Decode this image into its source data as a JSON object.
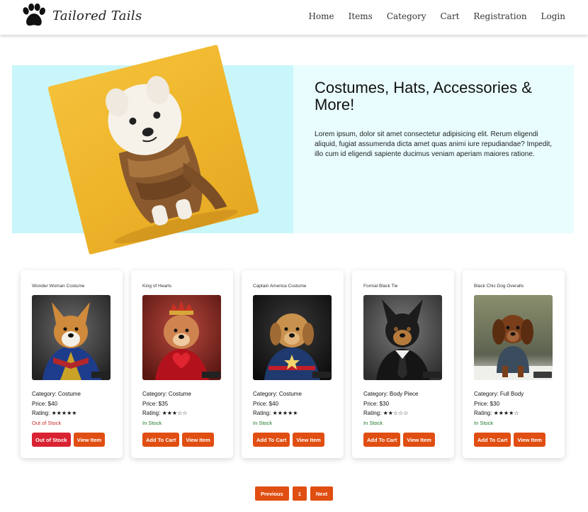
{
  "brand": {
    "name": "Tailored Tails",
    "logo_icon": "paw-icon"
  },
  "nav": {
    "items": [
      {
        "label": "Home"
      },
      {
        "label": "Items"
      },
      {
        "label": "Category"
      },
      {
        "label": "Cart"
      },
      {
        "label": "Registration"
      },
      {
        "label": "Login"
      }
    ]
  },
  "hero": {
    "title": "Costumes, Hats, Accessories & More!",
    "text": "Lorem ipsum, dolor sit amet consectetur adipisicing elit. Rerum eligendi aliquid, fugiat assumenda dicta amet quas animi iure repudiandae? Impedit, illo cum id eligendi sapiente ducimus veniam aperiam maiores ratione.",
    "colors": {
      "panel_left": "#c9f6fb",
      "panel_right": "#e9fdfe",
      "image_bg": "#f0b82f"
    }
  },
  "labels": {
    "category": "Category: ",
    "price": "Price: ",
    "rating": "Rating: ",
    "view_item": "View Item"
  },
  "products": [
    {
      "title": "Wonder Woman Costume",
      "category": "Costume",
      "price": "$40",
      "stars": "★★★★★",
      "stock": "Out of Stock",
      "in_stock": false,
      "action": "Out of Stock"
    },
    {
      "title": "King of Hearts",
      "category": "Costume",
      "price": "$35",
      "stars": "★★★☆☆",
      "stock": "In Stock",
      "in_stock": true,
      "action": "Add To Cart"
    },
    {
      "title": "Captain America Costume",
      "category": "Costume",
      "price": "$40",
      "stars": "★★★★★",
      "stock": "In Stock",
      "in_stock": true,
      "action": "Add To Cart"
    },
    {
      "title": "Formal Black Tie",
      "category": "Body Piece",
      "price": "$30",
      "stars": "★★☆☆☆",
      "stock": "In Stock",
      "in_stock": true,
      "action": "Add To Cart"
    },
    {
      "title": "Black Chic Dog Overalls",
      "category": "Full Body",
      "price": "$30",
      "stars": "★★★★☆",
      "stock": "In Stock",
      "in_stock": true,
      "action": "Add To Cart"
    }
  ],
  "pagination": {
    "previous": "Previous",
    "page": "1",
    "next": "Next"
  },
  "colors": {
    "accent": "#e04e12",
    "danger": "#d92332",
    "in_stock": "#1f7a2c",
    "out_of_stock": "#c92a2a"
  }
}
